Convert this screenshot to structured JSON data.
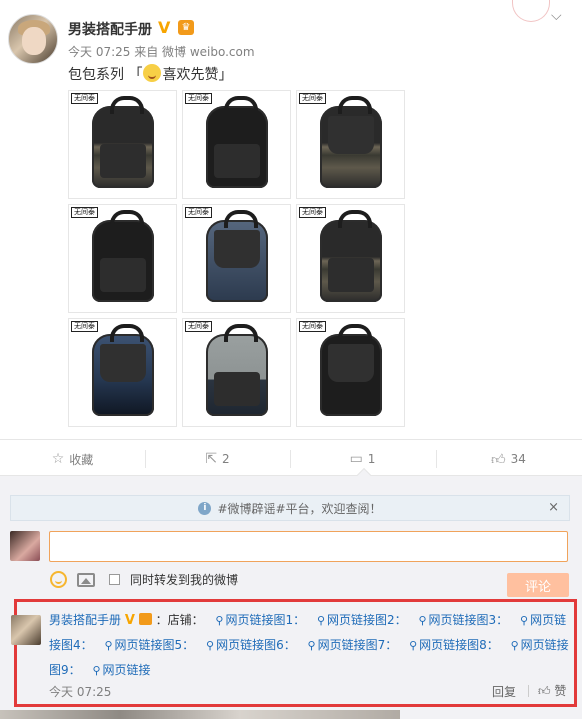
{
  "post": {
    "author": "男装搭配手册",
    "verified_mark": "V",
    "meta": "今天 07:25 来自 微博 weibo.com",
    "text_before": "包包系列 「",
    "text_after": "喜欢先赞」",
    "image_tags": [
      "无间泰",
      "无间泰",
      "无间泰",
      "无间泰",
      "无间泰",
      "无间泰",
      "无间泰",
      "无间泰",
      "无间泰"
    ]
  },
  "actions": {
    "favorite": "收藏",
    "repost_count": "2",
    "comment_count": "1",
    "like_count": "34"
  },
  "notice": {
    "text": "#微博辟谣#平台，欢迎查阅！",
    "close": "×"
  },
  "composer": {
    "forward_label": "同时转发到我的微博",
    "submit": "评论"
  },
  "comment": {
    "author": "男装搭配手册",
    "verified_mark": "V",
    "prefix": "：店铺：",
    "links": [
      "网页链接图1：",
      "网页链接图2：",
      "网页链接图3：",
      "网页链接图4：",
      "网页链接图5：",
      "网页链接图6：",
      "网页链接图7：",
      "网页链接图8：",
      "网页链接图9：",
      "网页链接"
    ],
    "time": "今天 07:25",
    "reply": "回复",
    "like": "赞"
  },
  "colors": {
    "link": "#1e6bb8",
    "highlight_box": "#e23a3a",
    "input_focus": "#f0a35b",
    "submit_disabled": "#ffc09f"
  }
}
